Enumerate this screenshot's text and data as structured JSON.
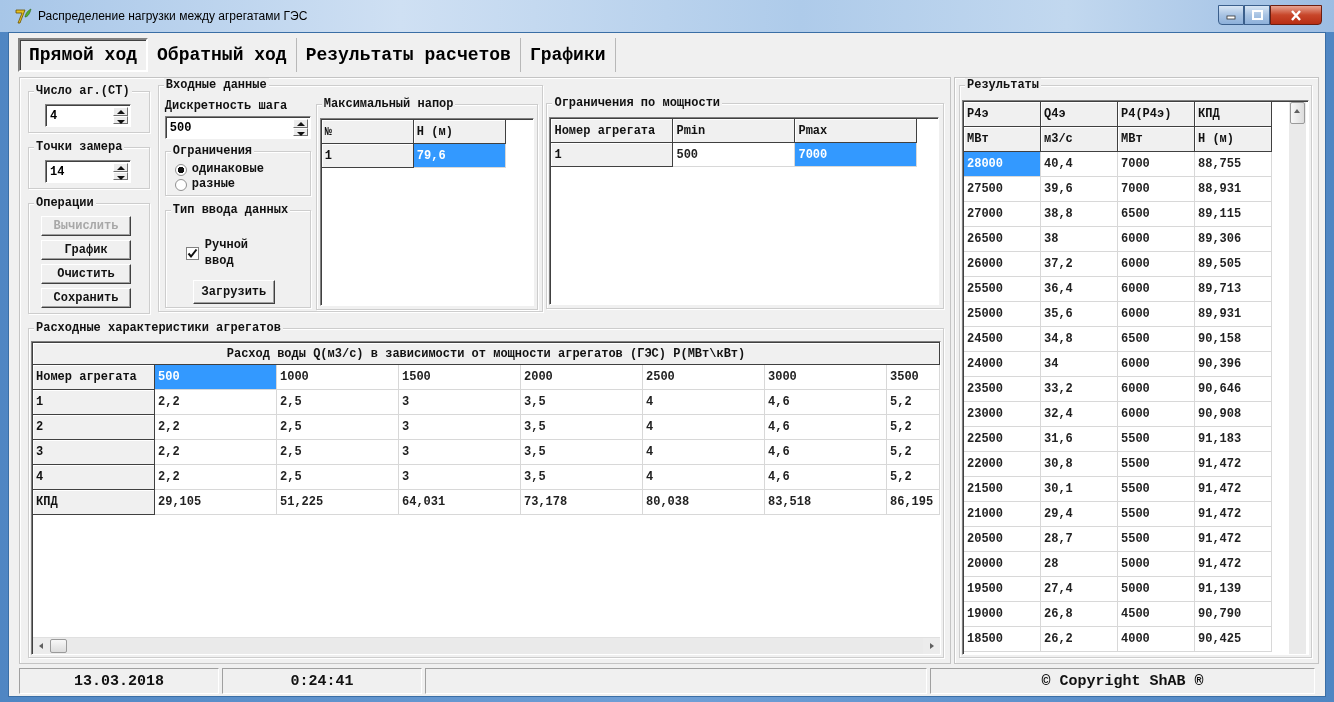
{
  "window": {
    "title": "Распределение нагрузки между агрегатами ГЭС"
  },
  "tabs": [
    {
      "label": "Прямой ход",
      "selected": true
    },
    {
      "label": "Обратный ход",
      "selected": false
    },
    {
      "label": "Результаты расчетов",
      "selected": false
    },
    {
      "label": "Графики",
      "selected": false
    }
  ],
  "unit_count": {
    "label": "Число аг.(СТ)",
    "value": "4"
  },
  "measure_points": {
    "label": "Точки замера",
    "value": "14"
  },
  "operations": {
    "label": "Операции",
    "buttons": [
      {
        "label": "Вычислить",
        "disabled": true
      },
      {
        "label": "График",
        "disabled": false
      },
      {
        "label": "Очистить",
        "disabled": false
      },
      {
        "label": "Сохранить",
        "disabled": false
      }
    ]
  },
  "input_data": {
    "label": "Входные данные",
    "step": {
      "label": "Дискретность шага",
      "value": "500"
    },
    "constraints": {
      "label": "Ограничения",
      "options": [
        {
          "label": "одинаковые",
          "selected": true
        },
        {
          "label": "разные",
          "selected": false
        }
      ]
    },
    "input_type": {
      "label": "Тип ввода данных",
      "manual_input": {
        "label": "Ручной ввод",
        "checked": true
      },
      "load_button": "Загрузить"
    }
  },
  "max_head": {
    "label": "Максимальный напор",
    "columns": [
      "№",
      "H (м)"
    ],
    "rows": [
      {
        "cells": [
          {
            "text": "1",
            "selected": false
          },
          {
            "text": "79,6",
            "selected": true
          }
        ]
      }
    ]
  },
  "power_limits": {
    "label": "Ограничения по мощности",
    "columns": [
      "Номер агрегата",
      "Pmin",
      "Pmax"
    ],
    "rows": [
      {
        "cells": [
          {
            "text": "1",
            "selected": false
          },
          {
            "text": "500",
            "selected": false
          },
          {
            "text": "7000",
            "selected": true
          }
        ]
      }
    ]
  },
  "flow_characteristics": {
    "label": "Расходные характеристики агрегатов",
    "caption": "Расход воды Q(м3/с) в зависимости от мощности агрегатов (ГЭС) P(МВт\\кВт)",
    "rows": [
      {
        "header": "Номер агрегата",
        "cells": [
          {
            "text": "500",
            "selected": true
          },
          {
            "text": "1000",
            "selected": false
          },
          {
            "text": "1500",
            "selected": false
          },
          {
            "text": "2000",
            "selected": false
          },
          {
            "text": "2500",
            "selected": false
          },
          {
            "text": "3000",
            "selected": false
          },
          {
            "text": "3500",
            "selected": false
          }
        ]
      },
      {
        "header": "1",
        "cells": [
          {
            "text": "2,2",
            "selected": false
          },
          {
            "text": "2,5",
            "selected": false
          },
          {
            "text": "3",
            "selected": false
          },
          {
            "text": "3,5",
            "selected": false
          },
          {
            "text": "4",
            "selected": false
          },
          {
            "text": "4,6",
            "selected": false
          },
          {
            "text": "5,2",
            "selected": false
          }
        ]
      },
      {
        "header": "2",
        "cells": [
          {
            "text": "2,2",
            "selected": false
          },
          {
            "text": "2,5",
            "selected": false
          },
          {
            "text": "3",
            "selected": false
          },
          {
            "text": "3,5",
            "selected": false
          },
          {
            "text": "4",
            "selected": false
          },
          {
            "text": "4,6",
            "selected": false
          },
          {
            "text": "5,2",
            "selected": false
          }
        ]
      },
      {
        "header": "3",
        "cells": [
          {
            "text": "2,2",
            "selected": false
          },
          {
            "text": "2,5",
            "selected": false
          },
          {
            "text": "3",
            "selected": false
          },
          {
            "text": "3,5",
            "selected": false
          },
          {
            "text": "4",
            "selected": false
          },
          {
            "text": "4,6",
            "selected": false
          },
          {
            "text": "5,2",
            "selected": false
          }
        ]
      },
      {
        "header": "4",
        "cells": [
          {
            "text": "2,2",
            "selected": false
          },
          {
            "text": "2,5",
            "selected": false
          },
          {
            "text": "3",
            "selected": false
          },
          {
            "text": "3,5",
            "selected": false
          },
          {
            "text": "4",
            "selected": false
          },
          {
            "text": "4,6",
            "selected": false
          },
          {
            "text": "5,2",
            "selected": false
          }
        ]
      },
      {
        "header": "КПД",
        "cells": [
          {
            "text": "29,105",
            "selected": false
          },
          {
            "text": "51,225",
            "selected": false
          },
          {
            "text": "64,031",
            "selected": false
          },
          {
            "text": "73,178",
            "selected": false
          },
          {
            "text": "80,038",
            "selected": false
          },
          {
            "text": "83,518",
            "selected": false
          },
          {
            "text": "86,195",
            "selected": false
          }
        ]
      }
    ]
  },
  "results": {
    "label": "Результаты",
    "header_rows": [
      [
        "P4э",
        "Q4э",
        "P4(P4э)",
        "КПД"
      ],
      [
        "МВт",
        "м3/с",
        "МВт",
        "H (м)"
      ]
    ],
    "rows": [
      {
        "cells": [
          {
            "text": "28000",
            "selected": true
          },
          {
            "text": "40,4",
            "selected": false
          },
          {
            "text": "7000",
            "selected": false
          },
          {
            "text": "88,755",
            "selected": false
          }
        ]
      },
      {
        "cells": [
          {
            "text": "27500",
            "selected": false
          },
          {
            "text": "39,6",
            "selected": false
          },
          {
            "text": "7000",
            "selected": false
          },
          {
            "text": "88,931",
            "selected": false
          }
        ]
      },
      {
        "cells": [
          {
            "text": "27000",
            "selected": false
          },
          {
            "text": "38,8",
            "selected": false
          },
          {
            "text": "6500",
            "selected": false
          },
          {
            "text": "89,115",
            "selected": false
          }
        ]
      },
      {
        "cells": [
          {
            "text": "26500",
            "selected": false
          },
          {
            "text": "38",
            "selected": false
          },
          {
            "text": "6000",
            "selected": false
          },
          {
            "text": "89,306",
            "selected": false
          }
        ]
      },
      {
        "cells": [
          {
            "text": "26000",
            "selected": false
          },
          {
            "text": "37,2",
            "selected": false
          },
          {
            "text": "6000",
            "selected": false
          },
          {
            "text": "89,505",
            "selected": false
          }
        ]
      },
      {
        "cells": [
          {
            "text": "25500",
            "selected": false
          },
          {
            "text": "36,4",
            "selected": false
          },
          {
            "text": "6000",
            "selected": false
          },
          {
            "text": "89,713",
            "selected": false
          }
        ]
      },
      {
        "cells": [
          {
            "text": "25000",
            "selected": false
          },
          {
            "text": "35,6",
            "selected": false
          },
          {
            "text": "6000",
            "selected": false
          },
          {
            "text": "89,931",
            "selected": false
          }
        ]
      },
      {
        "cells": [
          {
            "text": "24500",
            "selected": false
          },
          {
            "text": "34,8",
            "selected": false
          },
          {
            "text": "6500",
            "selected": false
          },
          {
            "text": "90,158",
            "selected": false
          }
        ]
      },
      {
        "cells": [
          {
            "text": "24000",
            "selected": false
          },
          {
            "text": "34",
            "selected": false
          },
          {
            "text": "6000",
            "selected": false
          },
          {
            "text": "90,396",
            "selected": false
          }
        ]
      },
      {
        "cells": [
          {
            "text": "23500",
            "selected": false
          },
          {
            "text": "33,2",
            "selected": false
          },
          {
            "text": "6000",
            "selected": false
          },
          {
            "text": "90,646",
            "selected": false
          }
        ]
      },
      {
        "cells": [
          {
            "text": "23000",
            "selected": false
          },
          {
            "text": "32,4",
            "selected": false
          },
          {
            "text": "6000",
            "selected": false
          },
          {
            "text": "90,908",
            "selected": false
          }
        ]
      },
      {
        "cells": [
          {
            "text": "22500",
            "selected": false
          },
          {
            "text": "31,6",
            "selected": false
          },
          {
            "text": "5500",
            "selected": false
          },
          {
            "text": "91,183",
            "selected": false
          }
        ]
      },
      {
        "cells": [
          {
            "text": "22000",
            "selected": false
          },
          {
            "text": "30,8",
            "selected": false
          },
          {
            "text": "5500",
            "selected": false
          },
          {
            "text": "91,472",
            "selected": false
          }
        ]
      },
      {
        "cells": [
          {
            "text": "21500",
            "selected": false
          },
          {
            "text": "30,1",
            "selected": false
          },
          {
            "text": "5500",
            "selected": false
          },
          {
            "text": "91,472",
            "selected": false
          }
        ]
      },
      {
        "cells": [
          {
            "text": "21000",
            "selected": false
          },
          {
            "text": "29,4",
            "selected": false
          },
          {
            "text": "5500",
            "selected": false
          },
          {
            "text": "91,472",
            "selected": false
          }
        ]
      },
      {
        "cells": [
          {
            "text": "20500",
            "selected": false
          },
          {
            "text": "28,7",
            "selected": false
          },
          {
            "text": "5500",
            "selected": false
          },
          {
            "text": "91,472",
            "selected": false
          }
        ]
      },
      {
        "cells": [
          {
            "text": "20000",
            "selected": false
          },
          {
            "text": "28",
            "selected": false
          },
          {
            "text": "5000",
            "selected": false
          },
          {
            "text": "91,472",
            "selected": false
          }
        ]
      },
      {
        "cells": [
          {
            "text": "19500",
            "selected": false
          },
          {
            "text": "27,4",
            "selected": false
          },
          {
            "text": "5000",
            "selected": false
          },
          {
            "text": "91,139",
            "selected": false
          }
        ]
      },
      {
        "cells": [
          {
            "text": "19000",
            "selected": false
          },
          {
            "text": "26,8",
            "selected": false
          },
          {
            "text": "4500",
            "selected": false
          },
          {
            "text": "90,790",
            "selected": false
          }
        ]
      },
      {
        "cells": [
          {
            "text": "18500",
            "selected": false
          },
          {
            "text": "26,2",
            "selected": false
          },
          {
            "text": "4000",
            "selected": false
          },
          {
            "text": "90,425",
            "selected": false
          }
        ]
      }
    ]
  },
  "status_bar": {
    "date": "13.03.2018",
    "time": "0:24:41",
    "copyright": "© Copyright ShAB ®"
  }
}
